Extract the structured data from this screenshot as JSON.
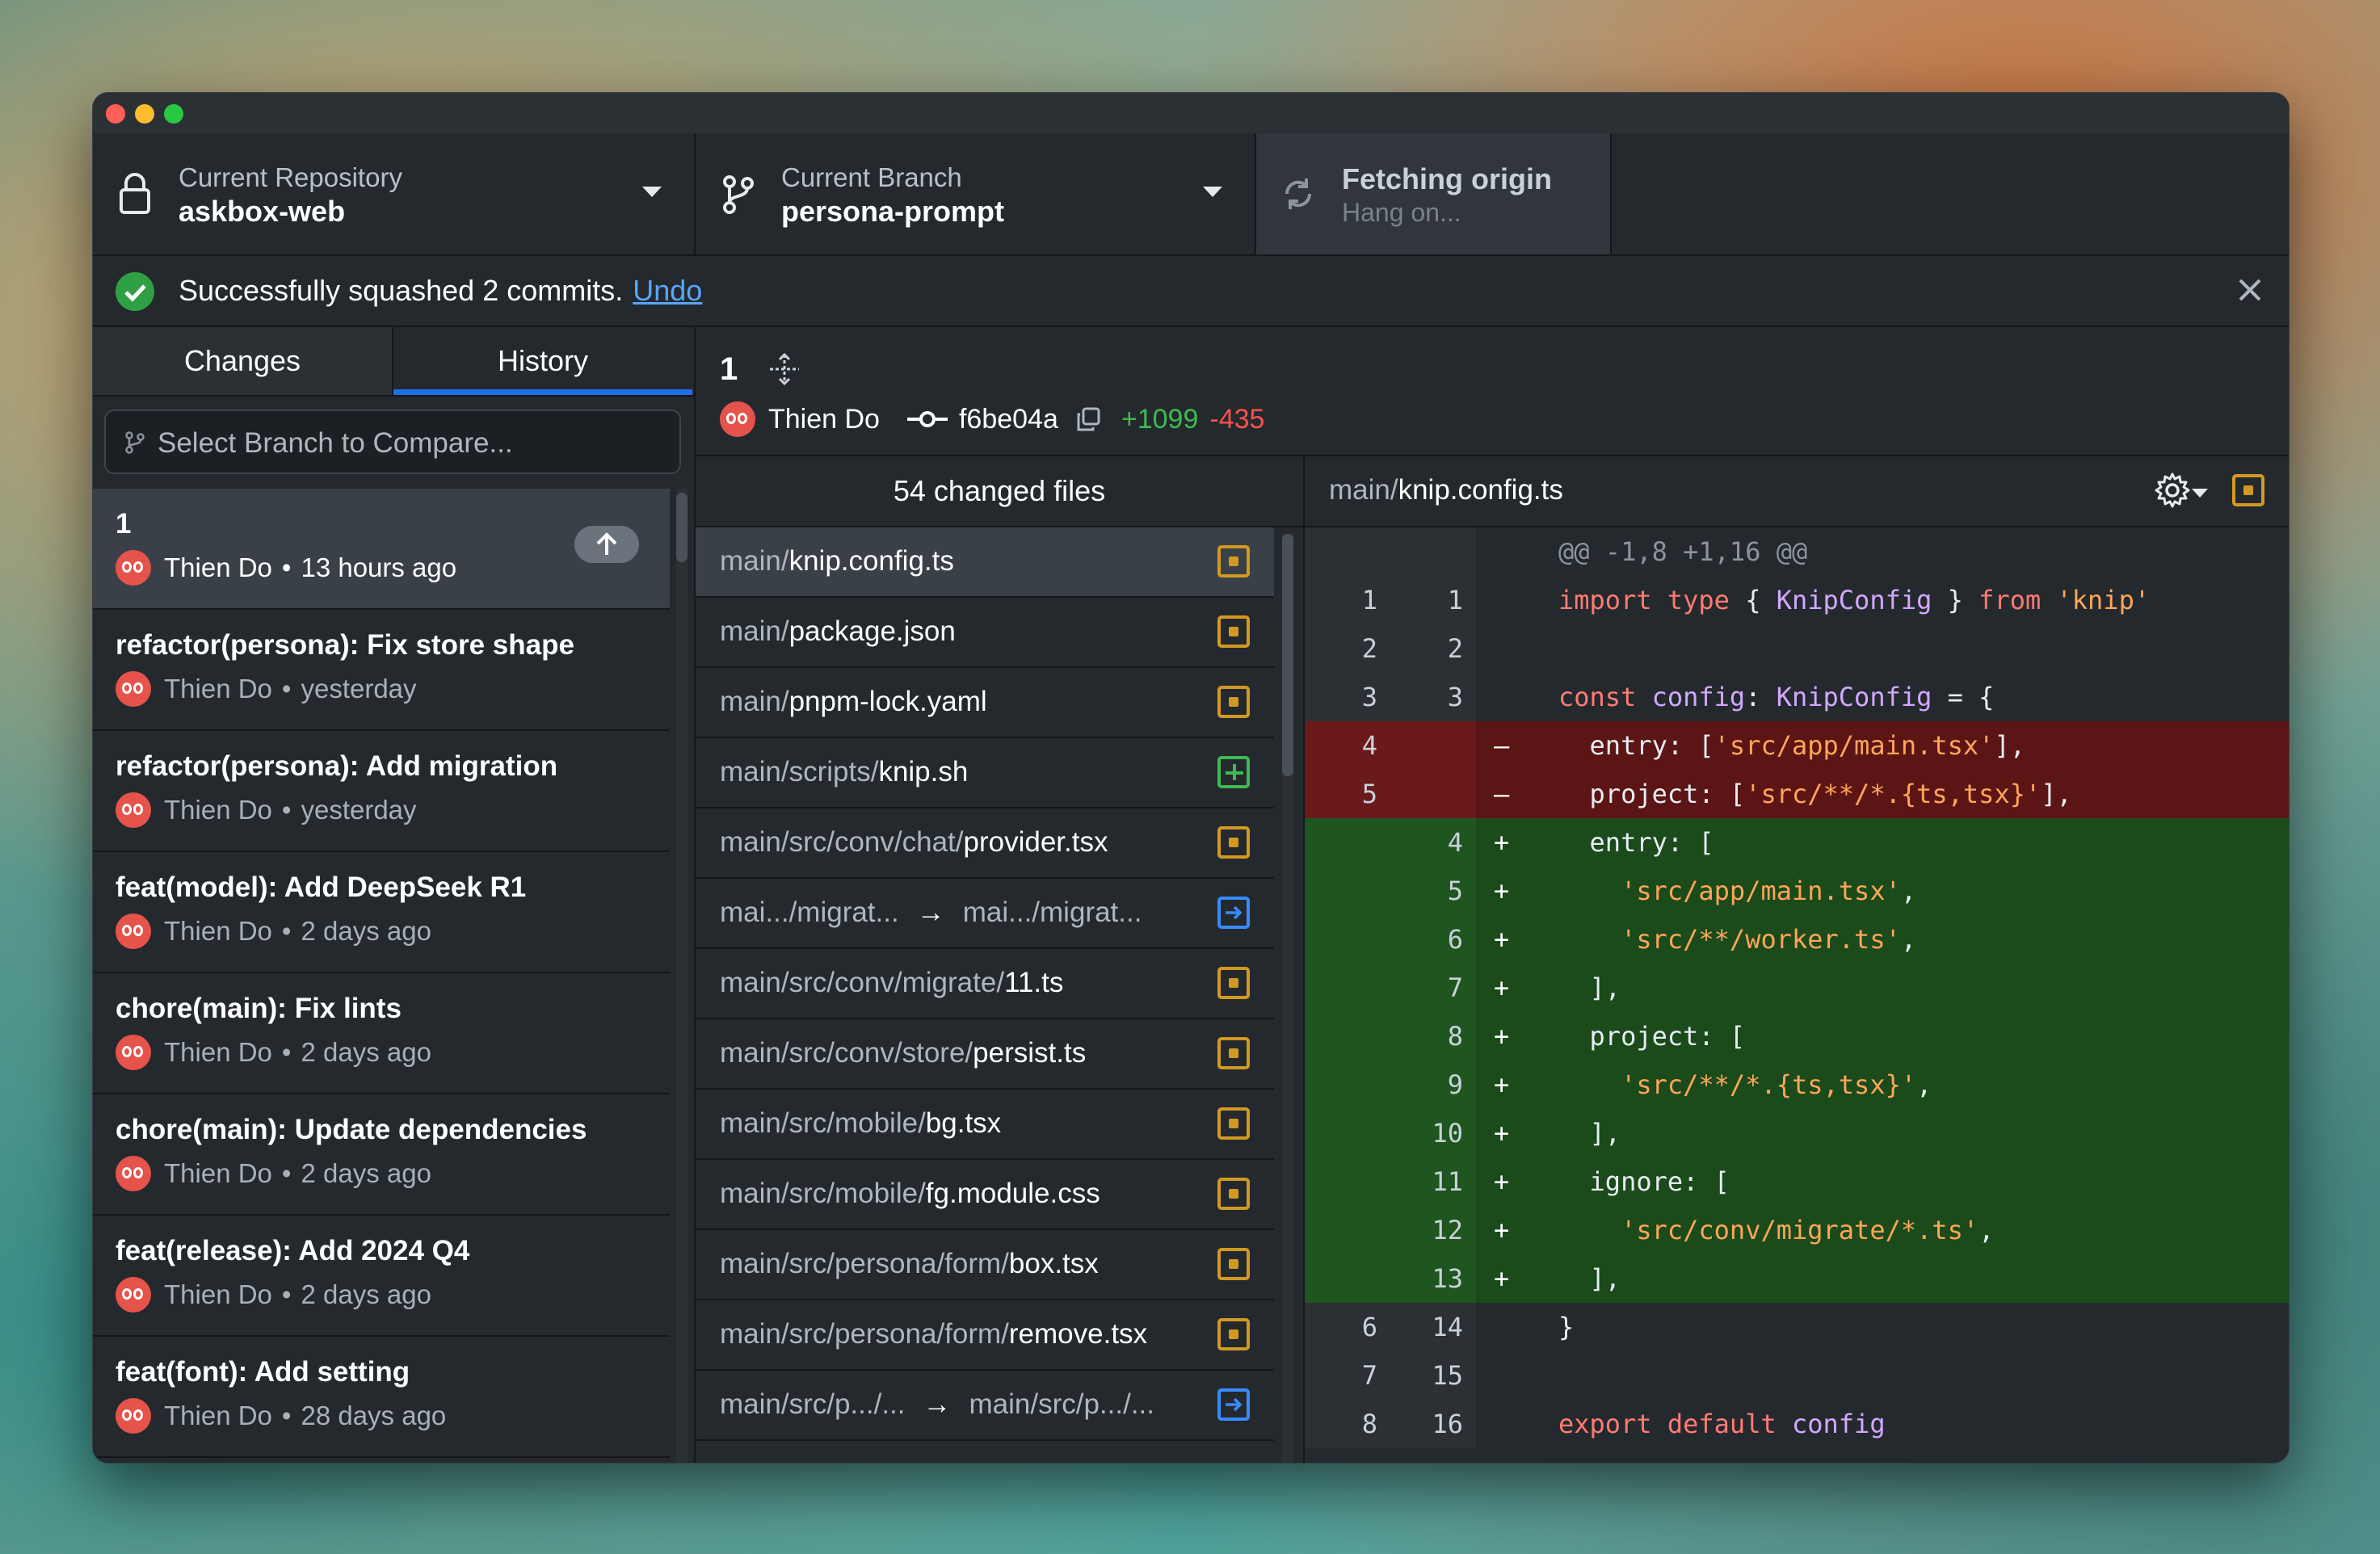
{
  "toolbar": {
    "repo_label": "Current Repository",
    "repo_value": "askbox-web",
    "branch_label": "Current Branch",
    "branch_value": "persona-prompt",
    "fetch_label": "Fetching origin",
    "fetch_value": "Hang on..."
  },
  "banner": {
    "message": "Successfully squashed 2 commits.",
    "undo": "Undo"
  },
  "tabs": {
    "changes": "Changes",
    "history": "History"
  },
  "compare": {
    "placeholder": "Select Branch to Compare..."
  },
  "commits": [
    {
      "title": "1",
      "author": "Thien Do",
      "time": "13 hours ago"
    },
    {
      "title": "refactor(persona): Fix store shape",
      "author": "Thien Do",
      "time": "yesterday"
    },
    {
      "title": "refactor(persona): Add migration",
      "author": "Thien Do",
      "time": "yesterday"
    },
    {
      "title": "feat(model): Add DeepSeek R1",
      "author": "Thien Do",
      "time": "2 days ago"
    },
    {
      "title": "chore(main): Fix lints",
      "author": "Thien Do",
      "time": "2 days ago"
    },
    {
      "title": "chore(main): Update dependencies",
      "author": "Thien Do",
      "time": "2 days ago"
    },
    {
      "title": "feat(release): Add 2024 Q4",
      "author": "Thien Do",
      "time": "2 days ago"
    },
    {
      "title": "feat(font): Add setting",
      "author": "Thien Do",
      "time": "28 days ago"
    }
  ],
  "commit_header": {
    "title": "1",
    "author": "Thien Do",
    "sha": "f6be04a",
    "additions": "+1099",
    "deletions": "-435"
  },
  "files": {
    "header": "54 changed files",
    "items": [
      {
        "dir": "main/",
        "name": "knip.config.ts",
        "status": "modified"
      },
      {
        "dir": "main/",
        "name": "package.json",
        "status": "modified"
      },
      {
        "dir": "main/",
        "name": "pnpm-lock.yaml",
        "status": "modified"
      },
      {
        "dir": "main/scripts/",
        "name": "knip.sh",
        "status": "added"
      },
      {
        "dir": "main/src/conv/chat/",
        "name": "provider.tsx",
        "status": "modified"
      },
      {
        "from": "mai.../migrat...",
        "to": "mai.../migrat...",
        "status": "renamed"
      },
      {
        "dir": "main/src/conv/migrate/",
        "name": "11.ts",
        "status": "modified"
      },
      {
        "dir": "main/src/conv/store/",
        "name": "persist.ts",
        "status": "modified"
      },
      {
        "dir": "main/src/mobile/",
        "name": "bg.tsx",
        "status": "modified"
      },
      {
        "dir": "main/src/mobile/",
        "name": "fg.module.css",
        "status": "modified"
      },
      {
        "dir": "main/src/persona/form/",
        "name": "box.tsx",
        "status": "modified"
      },
      {
        "dir": "main/src/persona/form/",
        "name": "remove.tsx",
        "status": "modified"
      },
      {
        "from": "main/src/p.../...",
        "to": "main/src/p.../...",
        "status": "renamed"
      }
    ]
  },
  "diff": {
    "path_dir": "main/",
    "path_name": "knip.config.ts",
    "hunk": "@@ -1,8 +1,16 @@",
    "lines": [
      {
        "type": "ctx",
        "old": "1",
        "new": "1",
        "marker": "",
        "text": "import type { KnipConfig } from 'knip'"
      },
      {
        "type": "ctx",
        "old": "2",
        "new": "2",
        "marker": "",
        "text": ""
      },
      {
        "type": "ctx",
        "old": "3",
        "new": "3",
        "marker": "",
        "text": "const config: KnipConfig = {"
      },
      {
        "type": "del",
        "old": "4",
        "new": "",
        "marker": "–",
        "text": "  entry: ['src/app/main.tsx'],"
      },
      {
        "type": "del",
        "old": "5",
        "new": "",
        "marker": "–",
        "text": "  project: ['src/**/*.{ts,tsx}'],"
      },
      {
        "type": "add",
        "old": "",
        "new": "4",
        "marker": "+",
        "text": "  entry: ["
      },
      {
        "type": "add",
        "old": "",
        "new": "5",
        "marker": "+",
        "text": "    'src/app/main.tsx',"
      },
      {
        "type": "add",
        "old": "",
        "new": "6",
        "marker": "+",
        "text": "    'src/**/worker.ts',"
      },
      {
        "type": "add",
        "old": "",
        "new": "7",
        "marker": "+",
        "text": "  ],"
      },
      {
        "type": "add",
        "old": "",
        "new": "8",
        "marker": "+",
        "text": "  project: ["
      },
      {
        "type": "add",
        "old": "",
        "new": "9",
        "marker": "+",
        "text": "    'src/**/*.{ts,tsx}',"
      },
      {
        "type": "add",
        "old": "",
        "new": "10",
        "marker": "+",
        "text": "  ],"
      },
      {
        "type": "add",
        "old": "",
        "new": "11",
        "marker": "+",
        "text": "  ignore: ["
      },
      {
        "type": "add",
        "old": "",
        "new": "12",
        "marker": "+",
        "text": "    'src/conv/migrate/*.ts',"
      },
      {
        "type": "add",
        "old": "",
        "new": "13",
        "marker": "+",
        "text": "  ],"
      },
      {
        "type": "ctx",
        "old": "6",
        "new": "14",
        "marker": "",
        "text": "}"
      },
      {
        "type": "ctx",
        "old": "7",
        "new": "15",
        "marker": "",
        "text": ""
      },
      {
        "type": "ctx",
        "old": "8",
        "new": "16",
        "marker": "",
        "text": "export default config"
      }
    ]
  },
  "colors": {
    "accent": "#1f6feb",
    "link": "#58a6ff",
    "success": "#2ea043",
    "added": "#3fb950",
    "deleted": "#f85149",
    "modified": "#d29922",
    "renamed": "#388bfd",
    "avatar": "#e5534b"
  },
  "icons": {
    "repo": "lock-icon",
    "branch": "git-branch-icon",
    "fetch": "sync-icon",
    "banner": "check-circle-icon",
    "close": "close-icon",
    "push": "arrow-up-icon",
    "move": "move-icon",
    "sha": "git-commit-icon",
    "copy": "copy-icon",
    "settings": "gear-icon"
  }
}
